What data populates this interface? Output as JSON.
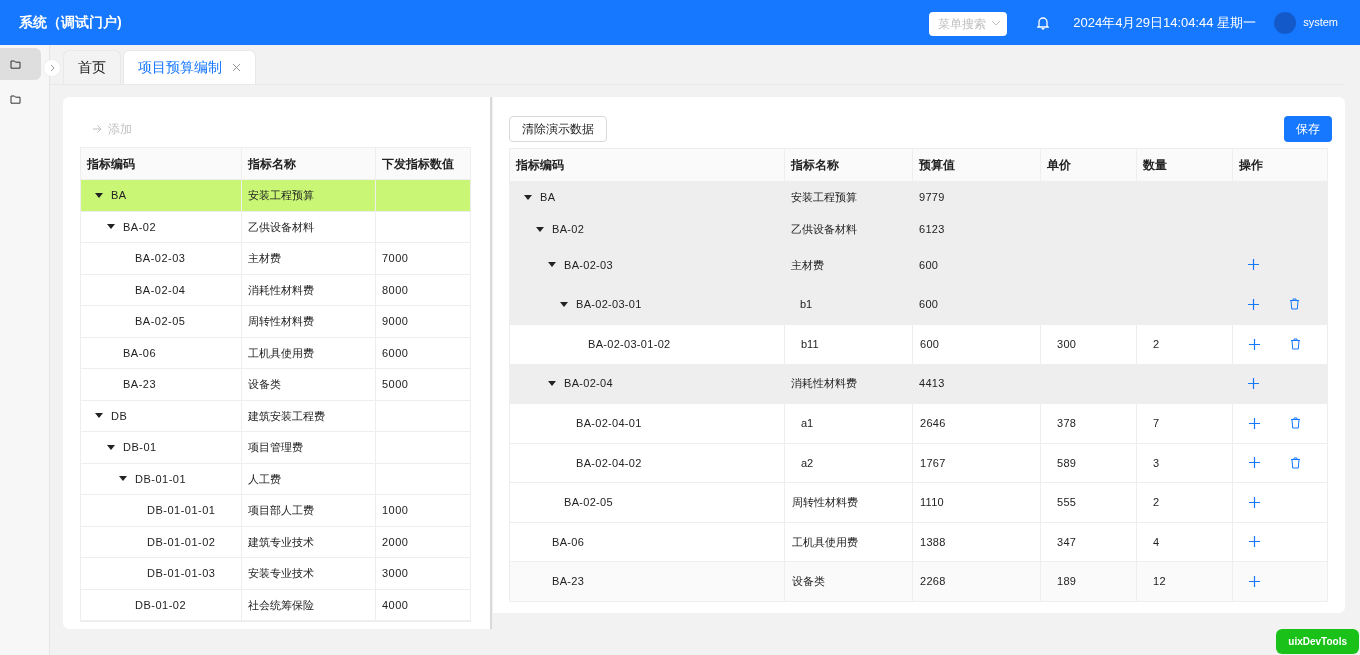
{
  "header": {
    "title": "系统（调试门户)",
    "menu_search": {
      "placeholder": "菜单搜索"
    },
    "datetime": "2024年4月29日14:04:44 星期一",
    "user": "system"
  },
  "sidebar": {
    "items": [
      {
        "selected": true
      },
      {
        "selected": false
      }
    ]
  },
  "tabs": [
    {
      "label": "首页",
      "selected": false,
      "closable": false
    },
    {
      "label": "项目预算编制",
      "selected": true,
      "closable": true
    }
  ],
  "left_panel": {
    "add_button": {
      "label": "添加",
      "disabled": true
    },
    "table": {
      "columns": [
        "指标编码",
        "指标名称",
        "下发指标数值"
      ],
      "rows": [
        {
          "code": "BA",
          "name": "安装工程预算",
          "selected": true,
          "expanded": true,
          "children": [
            {
              "code": "BA-02",
              "name": "乙供设备材料",
              "selected": false,
              "expanded": true,
              "children": [
                {
                  "code": "BA-02-03",
                  "name": "主材费",
                  "value": "7000",
                  "selected": false
                },
                {
                  "code": "BA-02-04",
                  "name": "消耗性材料费",
                  "value": "8000",
                  "selected": false
                },
                {
                  "code": "BA-02-05",
                  "name": "周转性材料费",
                  "value": "9000",
                  "selected": false
                }
              ]
            },
            {
              "code": "BA-06",
              "name": "工机具使用费",
              "value": "6000",
              "selected": false
            },
            {
              "code": "BA-23",
              "name": "设备类",
              "value": "5000",
              "selected": false
            }
          ]
        },
        {
          "code": "DB",
          "name": "建筑安装工程费",
          "selected": false,
          "expanded": true,
          "children": [
            {
              "code": "DB-01",
              "name": "项目管理费",
              "selected": false,
              "expanded": true,
              "children": [
                {
                  "code": "DB-01-01",
                  "name": "人工费",
                  "selected": false,
                  "expanded": true,
                  "children": [
                    {
                      "code": "DB-01-01-01",
                      "name": "项目部人工费",
                      "value": "1000",
                      "selected": false
                    },
                    {
                      "code": "DB-01-01-02",
                      "name": "建筑专业技术",
                      "value": "2000",
                      "selected": false
                    },
                    {
                      "code": "DB-01-01-03",
                      "name": "安装专业技术",
                      "value": "3000",
                      "selected": false
                    }
                  ]
                },
                {
                  "code": "DB-01-02",
                  "name": "社会统筹保险",
                  "value": "4000",
                  "selected": false
                }
              ]
            }
          ]
        }
      ]
    }
  },
  "right_panel": {
    "clear_button": "清除演示数据",
    "save_button": "保存",
    "table": {
      "columns": [
        "指标编码",
        "指标名称",
        "预算值",
        "单价",
        "数量",
        "操作"
      ],
      "rows": [
        {
          "code": "BA",
          "name": "安装工程预算",
          "budget": "9779",
          "expanded": true,
          "hovered": false,
          "can_add": false,
          "can_delete": false,
          "children": [
            {
              "code": "BA-02",
              "name": "乙供设备材料",
              "budget": "6123",
              "expanded": true,
              "hovered": false,
              "can_add": false,
              "can_delete": false,
              "children": [
                {
                  "code": "BA-02-03",
                  "name": "主材费",
                  "budget": "600",
                  "expanded": true,
                  "hovered": false,
                  "can_add": true,
                  "can_delete": false,
                  "children": [
                    {
                      "code": "BA-02-03-01",
                      "name": "b1",
                      "budget": "600",
                      "expanded": true,
                      "hovered": false,
                      "can_add": true,
                      "can_delete": true,
                      "children": [
                        {
                          "code": "BA-02-03-01-02",
                          "name": "b11",
                          "budget": "600",
                          "unit_price": "300",
                          "quantity": "2",
                          "hovered": false,
                          "can_add": true,
                          "can_delete": true
                        }
                      ]
                    }
                  ]
                },
                {
                  "code": "BA-02-04",
                  "name": "消耗性材料费",
                  "budget": "4413",
                  "expanded": true,
                  "hovered": false,
                  "can_add": true,
                  "can_delete": false,
                  "children": [
                    {
                      "code": "BA-02-04-01",
                      "name": "a1",
                      "budget": "2646",
                      "unit_price": "378",
                      "quantity": "7",
                      "hovered": false,
                      "can_add": true,
                      "can_delete": true
                    },
                    {
                      "code": "BA-02-04-02",
                      "name": "a2",
                      "budget": "1767",
                      "unit_price": "589",
                      "quantity": "3",
                      "hovered": false,
                      "can_add": true,
                      "can_delete": true
                    }
                  ]
                },
                {
                  "code": "BA-02-05",
                  "name": "周转性材料费",
                  "budget": "1110",
                  "unit_price": "555",
                  "quantity": "2",
                  "hovered": false,
                  "can_add": true,
                  "can_delete": false
                }
              ]
            },
            {
              "code": "BA-06",
              "name": "工机具使用费",
              "budget": "1388",
              "unit_price": "347",
              "quantity": "4",
              "hovered": false,
              "can_add": true,
              "can_delete": false
            },
            {
              "code": "BA-23",
              "name": "设备类",
              "budget": "2268",
              "unit_price": "189",
              "quantity": "12",
              "hovered": true,
              "can_add": true,
              "can_delete": false
            }
          ]
        }
      ]
    }
  },
  "devtools_badge": "uixDevTools"
}
